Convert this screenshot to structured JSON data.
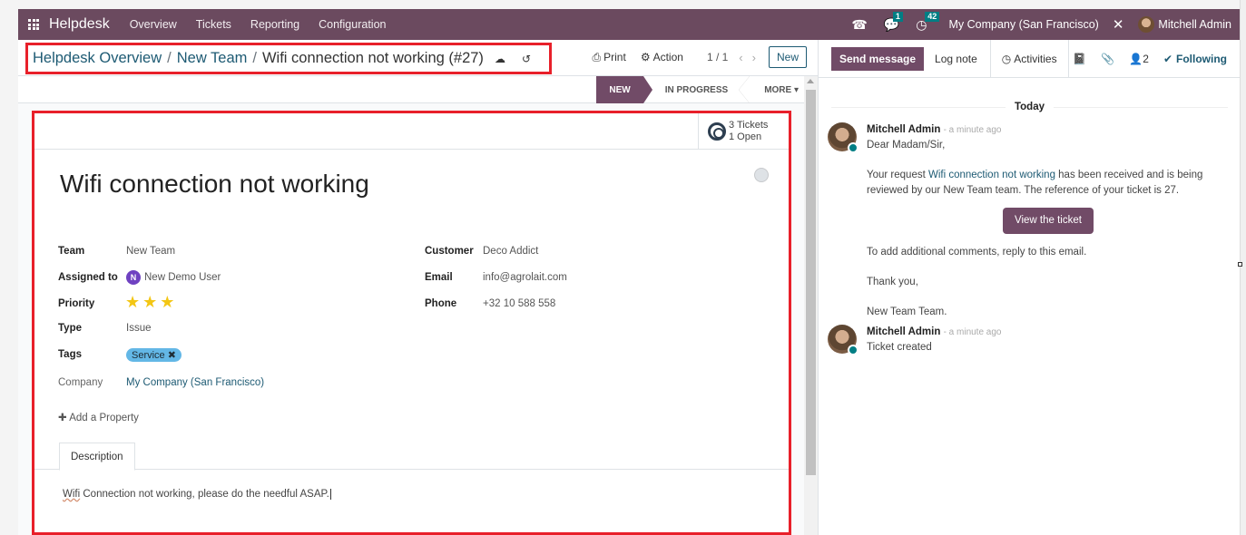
{
  "navbar": {
    "app_name": "Helpdesk",
    "menu": [
      "Overview",
      "Tickets",
      "Reporting",
      "Configuration"
    ],
    "icons": {
      "phone": "phone-icon",
      "chat": "chat-icon",
      "activity": "clock-icon",
      "tools": "tools-icon"
    },
    "chat_badge": "1",
    "activity_badge": "42",
    "company": "My Company (San Francisco)",
    "user": "Mitchell Admin"
  },
  "breadcrumb": {
    "items": [
      "Helpdesk Overview",
      "New Team"
    ],
    "current": "Wifi connection not working (#27)",
    "separator": "/"
  },
  "control": {
    "print": "Print",
    "action": "Action",
    "pager": "1 / 1",
    "new": "New"
  },
  "stages": {
    "active": "NEW",
    "next": "IN PROGRESS",
    "more": "MORE"
  },
  "smart_button": {
    "line1": "3 Tickets",
    "line2": "1 Open"
  },
  "ticket": {
    "title": "Wifi connection not working",
    "left_fields": {
      "team": {
        "label": "Team",
        "value": "New Team"
      },
      "assigned": {
        "label": "Assigned to",
        "value": "New Demo User",
        "initial": "N"
      },
      "priority": {
        "label": "Priority",
        "stars": 3,
        "max": 3
      },
      "type": {
        "label": "Type",
        "value": "Issue"
      },
      "tags": {
        "label": "Tags",
        "value": "Service"
      },
      "company": {
        "label": "Company",
        "value": "My Company (San Francisco)"
      }
    },
    "right_fields": {
      "customer": {
        "label": "Customer",
        "value": "Deco Addict"
      },
      "email": {
        "label": "Email",
        "value": "info@agrolait.com"
      },
      "phone": {
        "label": "Phone",
        "value": "+32 10 588 558"
      }
    },
    "add_property": "Add a Property",
    "tab": "Description",
    "description_first": "Wifi",
    "description_rest": " Connection not working, please do the needful ASAP."
  },
  "chatter": {
    "send_message": "Send message",
    "log_note": "Log note",
    "activities": "Activities",
    "followers_count": "2",
    "following": "Following",
    "date_separator": "Today",
    "messages": [
      {
        "author": "Mitchell Admin",
        "time": "- a minute ago",
        "greeting": "Dear Madam/Sir,",
        "body_pre": "Your request ",
        "body_link": "Wifi connection not working",
        "body_post": " has been received and is being reviewed by our New Team team. The reference of your ticket is 27.",
        "button": "View the ticket",
        "extra": "To add additional comments, reply to this email.",
        "thanks": "Thank you,",
        "signature": "New Team Team."
      },
      {
        "author": "Mitchell Admin",
        "time": "- a minute ago",
        "text": "Ticket created"
      }
    ]
  }
}
